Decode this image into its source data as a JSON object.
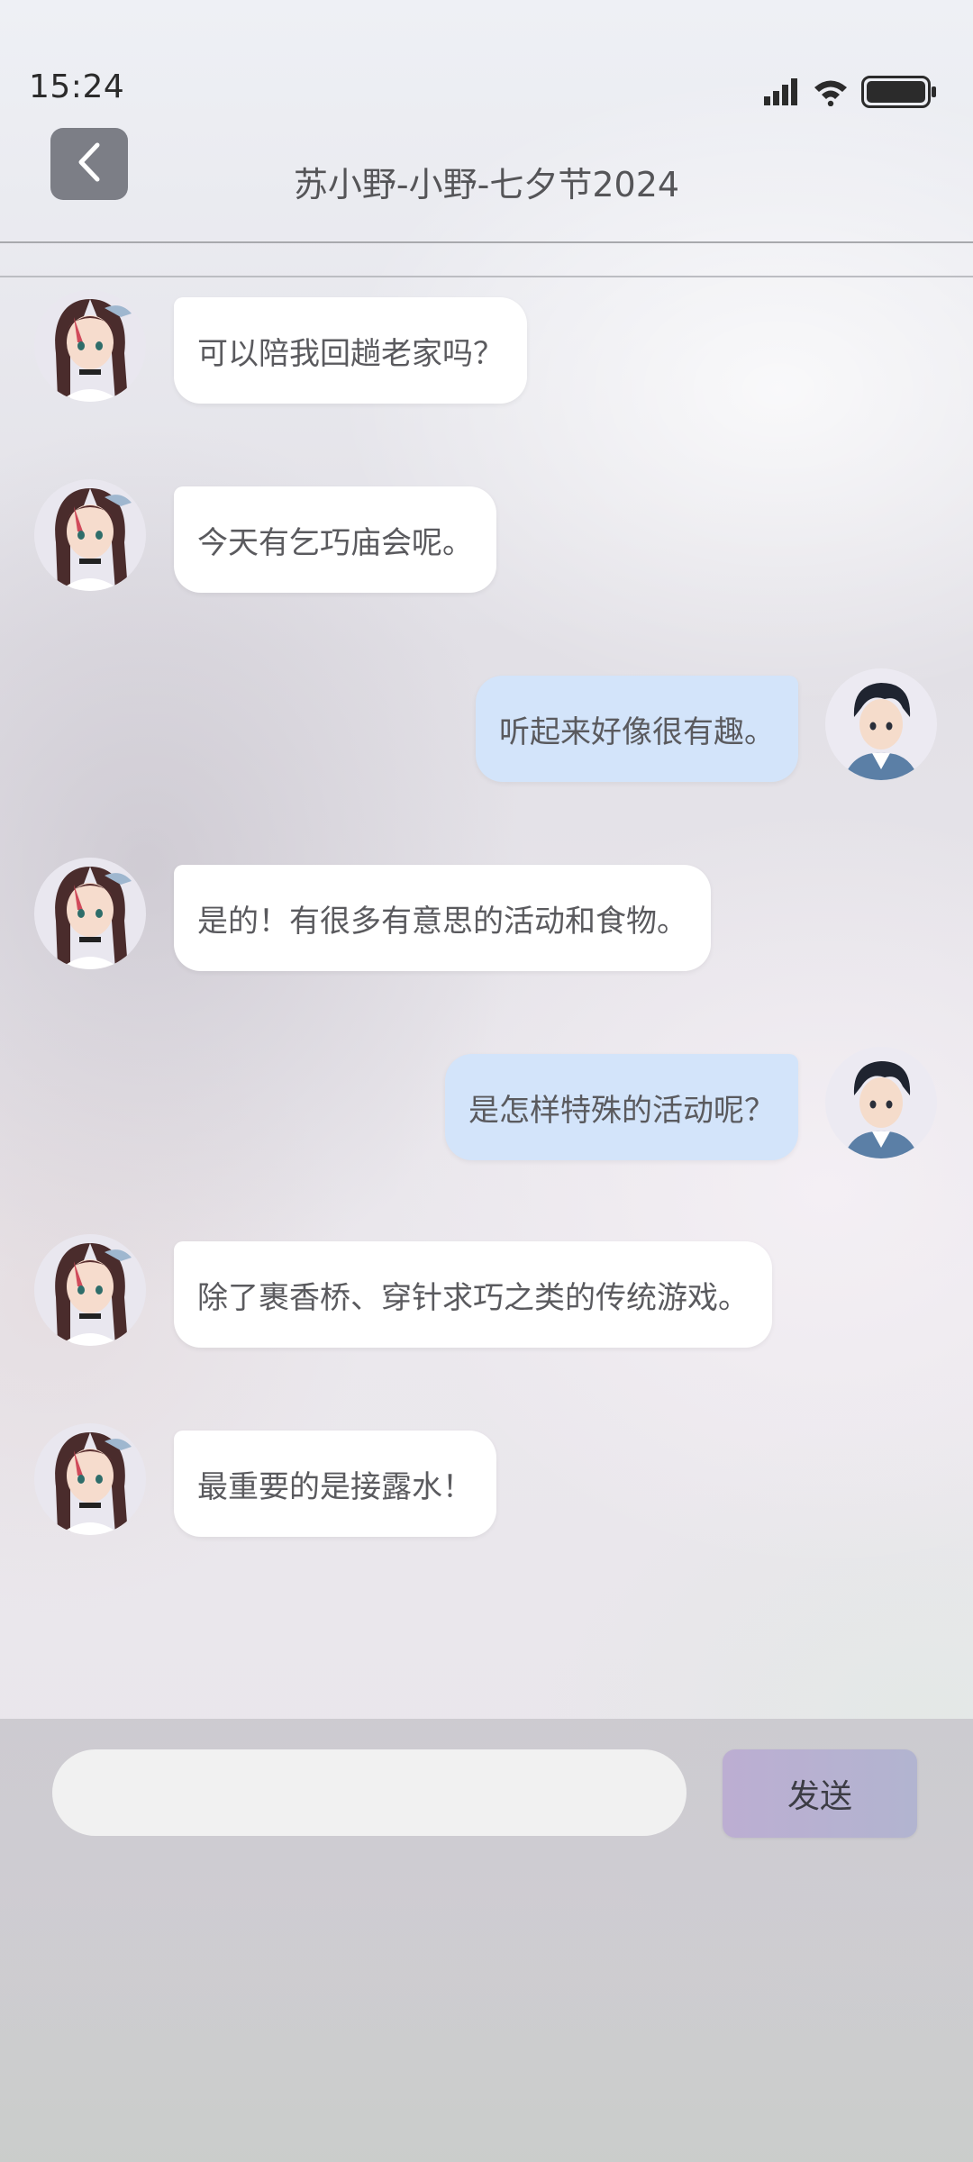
{
  "status_bar": {
    "time": "15:24"
  },
  "header": {
    "title": "苏小野-小野-七夕节2024",
    "back_icon": "chevron-left-icon"
  },
  "messages": [
    {
      "side": "left",
      "sender": "character",
      "text": "可以陪我回趟老家吗？"
    },
    {
      "side": "left",
      "sender": "character",
      "text": "今天有乞巧庙会呢。"
    },
    {
      "side": "right",
      "sender": "user",
      "text": "听起来好像很有趣。"
    },
    {
      "side": "left",
      "sender": "character",
      "text": "是的！有很多有意思的活动和食物。"
    },
    {
      "side": "right",
      "sender": "user",
      "text": "是怎样特殊的活动呢？"
    },
    {
      "side": "left",
      "sender": "character",
      "text": "除了裹香桥、穿针求巧之类的传统游戏。"
    },
    {
      "side": "left",
      "sender": "character",
      "text": "最重要的是接露水！"
    }
  ],
  "input": {
    "value": "",
    "placeholder": ""
  },
  "send_button": {
    "label": "发送"
  },
  "colors": {
    "left_bubble": "#ffffff",
    "right_bubble": "#d3e4fa",
    "back_button": "#7c7e86",
    "send_button_start": "#bcaed2",
    "send_button_end": "#b2b4d0"
  }
}
